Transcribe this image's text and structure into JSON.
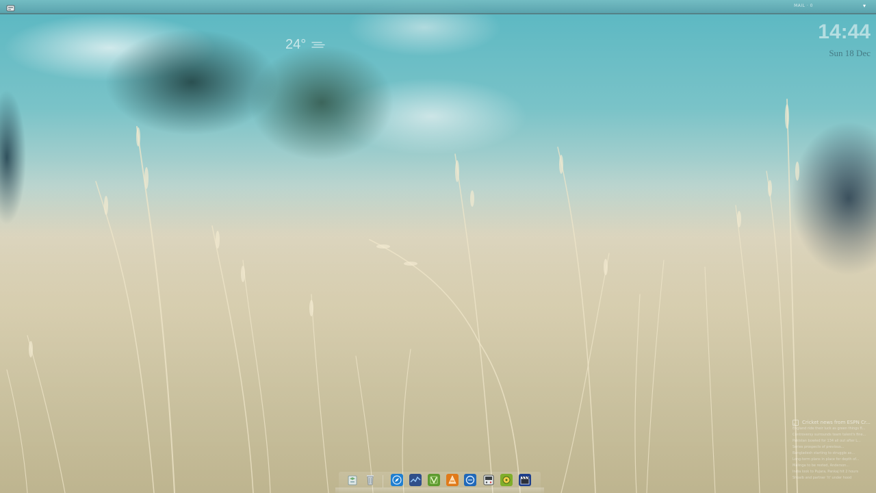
{
  "panel": {
    "tray_text": "MAIL · 0",
    "menu_icon": "gnome-foot-icon",
    "dropdown_glyph": "▾"
  },
  "clock": {
    "time": "14:44",
    "date": "Sun 18 Dec"
  },
  "weather": {
    "temperature": "24°",
    "icon": "fog-icon"
  },
  "news": {
    "title": "Cricket news from ESPN Cr...",
    "lines": [
      "England ride their luck as green things fl...",
      "Controversy surrounds team talent's fine...",
      "Pakistan bowled for 134 all out after L...",
      "Series prospects of previous...",
      "Bangladesh starting to struggle as...",
      "Long-term plans in place for depth of...",
      "Malinga to be rested, Anderson...",
      "India look to Pujara, Pankaj hit 2 hours",
      "Shoaib and partner 'it' under hood"
    ]
  },
  "dock": {
    "items": [
      {
        "name": "files",
        "icon": "file-manager-icon"
      },
      {
        "name": "trash",
        "icon": "trash-icon"
      },
      {
        "name": "browser",
        "icon": "compass-icon"
      },
      {
        "name": "system-monitor",
        "icon": "monitor-graph-icon"
      },
      {
        "name": "software",
        "icon": "software-center-icon"
      },
      {
        "name": "vlc",
        "icon": "media-player-icon"
      },
      {
        "name": "chat",
        "icon": "chat-icon"
      },
      {
        "name": "games",
        "icon": "gamepad-icon"
      },
      {
        "name": "music",
        "icon": "music-player-icon"
      },
      {
        "name": "video-editor",
        "icon": "clapperboard-icon"
      }
    ]
  },
  "colors": {
    "sky": "#59b7c2",
    "grass": "#cfc6a6",
    "panel": "#78bec3"
  }
}
